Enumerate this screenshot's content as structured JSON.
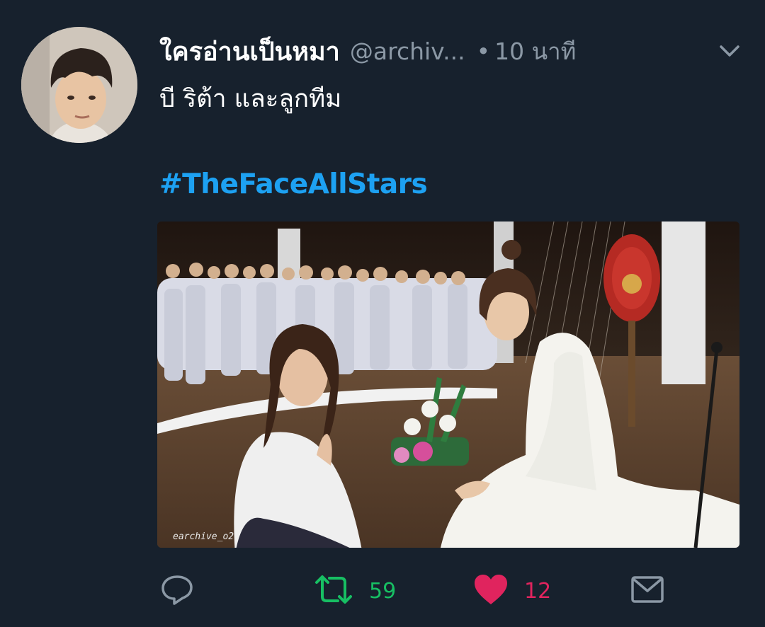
{
  "tweet": {
    "display_name": "ใครอ่านเป็นหมา",
    "handle": "@archiv...",
    "separator": "•",
    "time": "10 นาที",
    "text": "บี ริต้า และลูกทีม",
    "hashtag": "#TheFaceAllStars",
    "media_watermark": "earchive_o2"
  },
  "actions": {
    "reply_count": "",
    "retweet_count": "59",
    "like_count": "12"
  },
  "colors": {
    "background": "#17212d",
    "accent": "#1da1f2",
    "retweet": "#17bf63",
    "like": "#e0245e",
    "muted": "#8b98a5"
  },
  "icons": {
    "caret": "chevron-down-icon",
    "reply": "reply-icon",
    "retweet": "retweet-icon",
    "like": "heart-icon",
    "share": "envelope-icon"
  }
}
